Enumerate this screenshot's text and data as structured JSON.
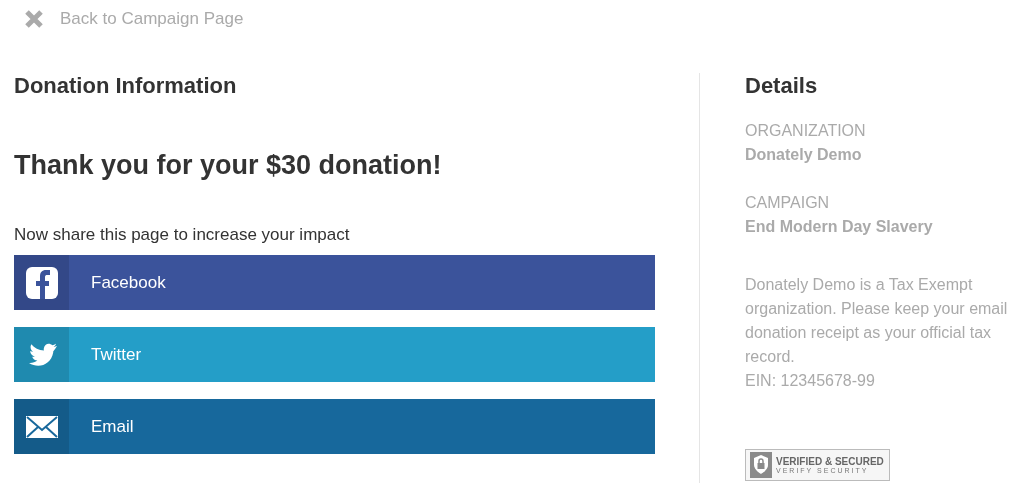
{
  "back_link": {
    "label": "Back to Campaign Page"
  },
  "donation": {
    "heading": "Donation Information",
    "thank_you": "Thank you for your $30 donation!",
    "share_prompt": "Now share this page to increase your impact",
    "share_buttons": [
      {
        "kind": "facebook",
        "label": "Facebook",
        "color": "#3b539b"
      },
      {
        "kind": "twitter",
        "label": "Twitter",
        "color": "#249ec8"
      },
      {
        "kind": "email",
        "label": "Email",
        "color": "#17689c"
      }
    ]
  },
  "details": {
    "heading": "Details",
    "fields": [
      {
        "label": "ORGANIZATION",
        "value": "Donately Demo"
      },
      {
        "label": "CAMPAIGN",
        "value": "End Modern Day Slavery"
      }
    ],
    "note": "Donately Demo is a Tax Exempt organization. Please keep your email donation receipt as your official tax record.",
    "ein": "EIN: 12345678-99",
    "seal": {
      "title": "VERIFIED & SECURED",
      "subtitle": "VERIFY SECURITY"
    }
  }
}
